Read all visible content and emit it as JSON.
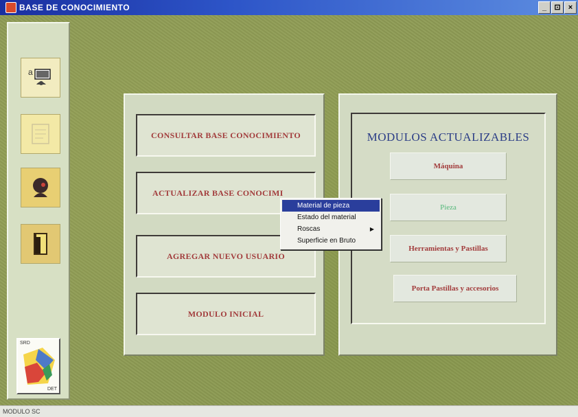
{
  "window": {
    "title": "BASE DE CONOCIMIENTO",
    "controls": [
      "_",
      "⊡",
      "×"
    ]
  },
  "sidebar": {
    "icons": [
      "query-person-icon",
      "document-icon",
      "user-head-icon",
      "exit-door-icon"
    ],
    "logo": {
      "top_text": "SRD",
      "bottom_text": "DET"
    }
  },
  "main_menu": {
    "buttons": [
      "CONSULTAR BASE CONOCIMIENTO",
      "ACTUALIZAR BASE CONOCIMI",
      "AGREGAR NUEVO USUARIO",
      "MODULO INICIAL"
    ]
  },
  "context_menu": {
    "items": [
      {
        "label": "Material de pieza",
        "selected": true,
        "has_submenu": false
      },
      {
        "label": "Estado del material",
        "selected": false,
        "has_submenu": false
      },
      {
        "label": "Roscas",
        "selected": false,
        "has_submenu": true
      },
      {
        "label": "Superficie en Bruto",
        "selected": false,
        "has_submenu": false
      }
    ]
  },
  "modules": {
    "title": "MODULOS ACTUALIZABLES",
    "buttons": [
      "Máquina",
      "Pieza",
      "Herramientas y Pastillas",
      "Porta Pastillas y accesorios"
    ]
  },
  "status_bar": {
    "text": "MODULO SC"
  },
  "colors": {
    "title_bar": "#1a2fa0",
    "button_text": "#a23c3c",
    "module_title": "#2a3c86",
    "pieza_text": "#55b87a",
    "selection": "#2a3e9c",
    "background": "#8f9c55"
  }
}
